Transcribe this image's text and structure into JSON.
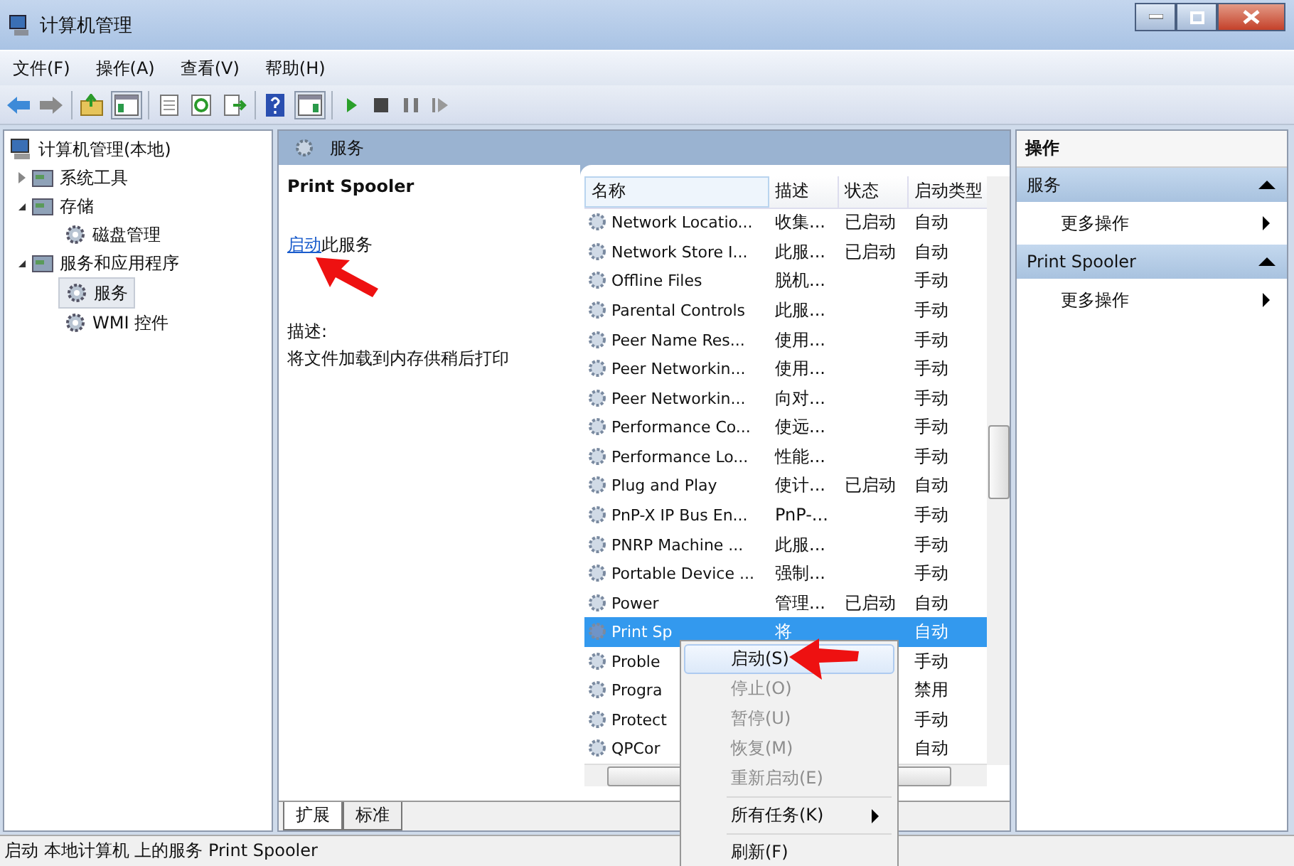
{
  "window": {
    "title": "计算机管理"
  },
  "menu_bar": [
    "文件(F)",
    "操作(A)",
    "查看(V)",
    "帮助(H)"
  ],
  "tree": [
    {
      "label": "计算机管理(本地)",
      "selected": false,
      "children": [
        {
          "label": "系统工具",
          "expanded": false,
          "selected": false
        },
        {
          "label": "存储",
          "expanded": true,
          "selected": false,
          "children": [
            {
              "label": "磁盘管理",
              "selected": false
            }
          ]
        },
        {
          "label": "服务和应用程序",
          "expanded": true,
          "selected": false,
          "children": [
            {
              "label": "服务",
              "selected": true
            },
            {
              "label": "WMI 控件",
              "selected": false
            }
          ]
        }
      ]
    }
  ],
  "services_panel": {
    "header": "服务",
    "service_name": "Print Spooler",
    "start_link": "启动",
    "start_link_rest": "此服务",
    "description_label": "描述:",
    "description": "将文件加载到内存供稍后打印",
    "columns": [
      "名称",
      "描述",
      "状态",
      "启动类型"
    ],
    "rows": [
      {
        "name": "Network Locatio...",
        "desc": "收集...",
        "status": "已启动",
        "startup": "自动",
        "selected": false
      },
      {
        "name": "Network Store I...",
        "desc": "此服...",
        "status": "已启动",
        "startup": "自动",
        "selected": false
      },
      {
        "name": "Offline Files",
        "desc": "脱机...",
        "startup": "手动",
        "selected": false
      },
      {
        "name": "Parental Controls",
        "desc": "此服...",
        "startup": "手动",
        "selected": false
      },
      {
        "name": "Peer Name Res...",
        "desc": "使用...",
        "startup": "手动",
        "selected": false
      },
      {
        "name": "Peer Networkin...",
        "desc": "使用...",
        "startup": "手动",
        "selected": false
      },
      {
        "name": "Peer Networkin...",
        "desc": "向对...",
        "startup": "手动",
        "selected": false
      },
      {
        "name": "Performance Co...",
        "desc": "使远...",
        "startup": "手动",
        "selected": false
      },
      {
        "name": "Performance Lo...",
        "desc": "性能...",
        "startup": "手动",
        "selected": false
      },
      {
        "name": "Plug and Play",
        "desc": "使计...",
        "status": "已启动",
        "startup": "自动",
        "selected": false
      },
      {
        "name": "PnP-X IP Bus En...",
        "desc": "PnP-...",
        "startup": "手动",
        "selected": false
      },
      {
        "name": "PNRP Machine ...",
        "desc": "此服...",
        "startup": "手动",
        "selected": false
      },
      {
        "name": "Portable Device ...",
        "desc": "强制...",
        "startup": "手动",
        "selected": false
      },
      {
        "name": "Power",
        "desc": "管理...",
        "status": "已启动",
        "startup": "自动",
        "selected": false
      },
      {
        "name": "Print Sp",
        "desc": "将",
        "startup": "自动",
        "selected": true
      },
      {
        "name": "Proble",
        "startup": "手动",
        "selected": false
      },
      {
        "name": "Progra",
        "startup": "禁用",
        "selected": false
      },
      {
        "name": "Protect",
        "startup": "手动",
        "selected": false
      },
      {
        "name": "QPCor",
        "startup": "自动",
        "selected": false
      }
    ],
    "tabs": [
      {
        "label": "扩展",
        "selected": true
      },
      {
        "label": "标准",
        "selected": false
      }
    ]
  },
  "actions_panel": {
    "title": "操作",
    "sections": [
      {
        "header": "服务",
        "items": [
          "更多操作"
        ]
      },
      {
        "header": "Print Spooler",
        "items": [
          "更多操作"
        ]
      }
    ]
  },
  "context_menu": [
    {
      "label": "启动(S)",
      "disabled": false,
      "selected": true,
      "submenu": false
    },
    {
      "label": "停止(O)",
      "disabled": true,
      "selected": false,
      "submenu": false
    },
    {
      "label": "暂停(U)",
      "disabled": true,
      "selected": false,
      "submenu": false
    },
    {
      "label": "恢复(M)",
      "disabled": true,
      "selected": false,
      "submenu": false
    },
    {
      "label": "重新启动(E)",
      "disabled": true,
      "selected": false,
      "submenu": false,
      "separator_after": true
    },
    {
      "label": "所有任务(K)",
      "disabled": false,
      "selected": false,
      "submenu": true,
      "separator_after": true
    },
    {
      "label": "刷新(F)",
      "disabled": false,
      "selected": false,
      "submenu": false
    }
  ],
  "status_bar": "启动 本地计算机 上的服务 Print Spooler"
}
